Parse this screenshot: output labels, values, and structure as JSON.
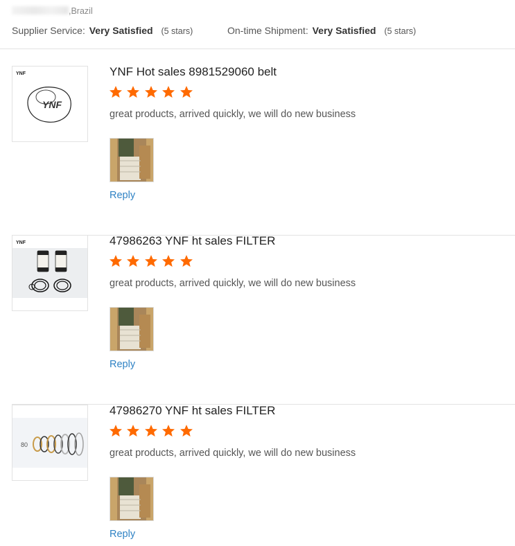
{
  "header": {
    "location_suffix": ",Brazil",
    "supplier_service_label": "Supplier Service:",
    "supplier_service_value": "Very Satisfied",
    "supplier_service_stars": "(5 stars)",
    "shipment_label": "On-time Shipment:",
    "shipment_value": "Very Satisfied",
    "shipment_stars": "(5 stars)"
  },
  "reviews": [
    {
      "title": "YNF Hot sales 8981529060 belt",
      "rating": 5,
      "comment": "great products, arrived quickly, we will do new business",
      "reply_label": "Reply"
    },
    {
      "title": "47986263 YNF ht sales FILTER",
      "rating": 5,
      "comment": "great products, arrived quickly, we will do new business",
      "reply_label": "Reply"
    },
    {
      "title": "47986270 YNF ht sales FILTER",
      "rating": 5,
      "comment": "great products, arrived quickly, we will do new business",
      "reply_label": "Reply"
    }
  ],
  "colors": {
    "star": "#ff6a00",
    "link": "#2f82c4"
  },
  "icons": {
    "star": "star-icon"
  }
}
